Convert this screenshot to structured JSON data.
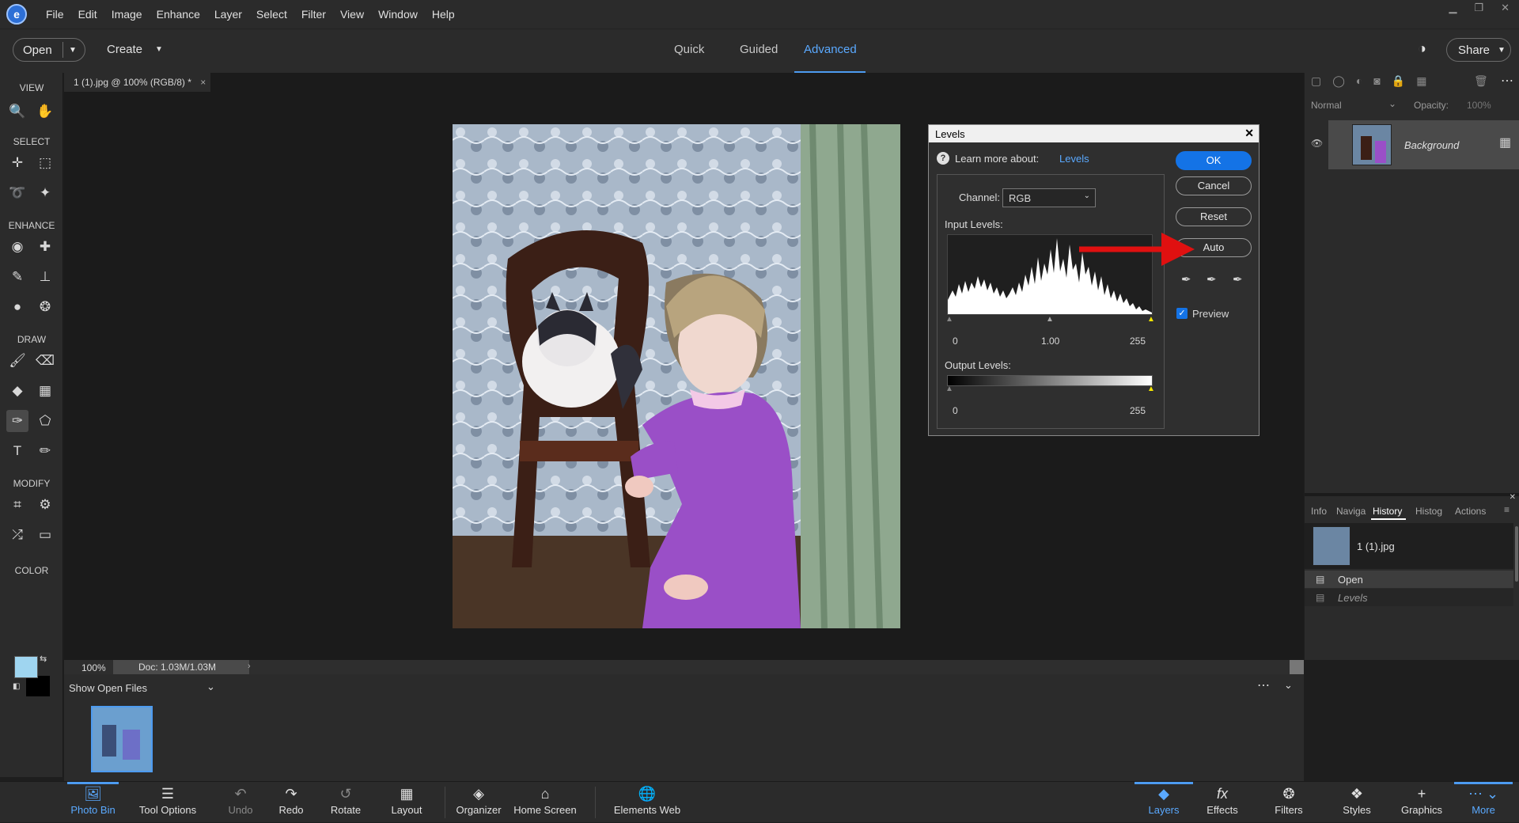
{
  "menubar": {
    "items": [
      "File",
      "Edit",
      "Image",
      "Enhance",
      "Layer",
      "Select",
      "Filter",
      "View",
      "Window",
      "Help"
    ]
  },
  "toolbar": {
    "open_label": "Open",
    "create_label": "Create",
    "share_label": "Share",
    "modes": [
      "Quick",
      "Guided",
      "Advanced"
    ],
    "active_mode": "Advanced"
  },
  "toolbox": {
    "view": "VIEW",
    "select": "SELECT",
    "enhance": "ENHANCE",
    "draw": "DRAW",
    "modify": "MODIFY",
    "color": "COLOR",
    "foreground_color": "#9fd5f0",
    "background_color": "#000000"
  },
  "document": {
    "tab_title": "1 (1).jpg @ 100% (RGB/8) *",
    "zoom": "100%",
    "doc_size": "Doc: 1.03M/1.03M"
  },
  "levels": {
    "title": "Levels",
    "learn_more": "Learn more about:",
    "learn_link": "Levels",
    "channel_label": "Channel:",
    "channel_value": "RGB",
    "input_levels_label": "Input Levels:",
    "input_values": [
      "0",
      "1.00",
      "255"
    ],
    "output_levels_label": "Output Levels:",
    "output_values": [
      "0",
      "255"
    ],
    "buttons": {
      "ok": "OK",
      "cancel": "Cancel",
      "reset": "Reset",
      "auto": "Auto"
    },
    "preview_label": "Preview",
    "preview_checked": true
  },
  "layers_panel": {
    "blend_mode": "Normal",
    "opacity_label": "Opacity:",
    "opacity_value": "100%",
    "layer_name": "Background"
  },
  "history_panel": {
    "tabs": [
      "Info",
      "Naviga",
      "History",
      "Histog",
      "Actions"
    ],
    "active_tab": "History",
    "snapshot": "1 (1).jpg",
    "steps": [
      "Open",
      "Levels"
    ]
  },
  "bin": {
    "show_label": "Show Open Files"
  },
  "taskbar": {
    "left": [
      "Photo Bin",
      "Tool Options",
      "Undo",
      "Redo",
      "Rotate",
      "Layout",
      "Organizer",
      "Home Screen",
      "Elements Web"
    ],
    "right": [
      "Layers",
      "Effects",
      "Filters",
      "Styles",
      "Graphics",
      "More"
    ]
  }
}
